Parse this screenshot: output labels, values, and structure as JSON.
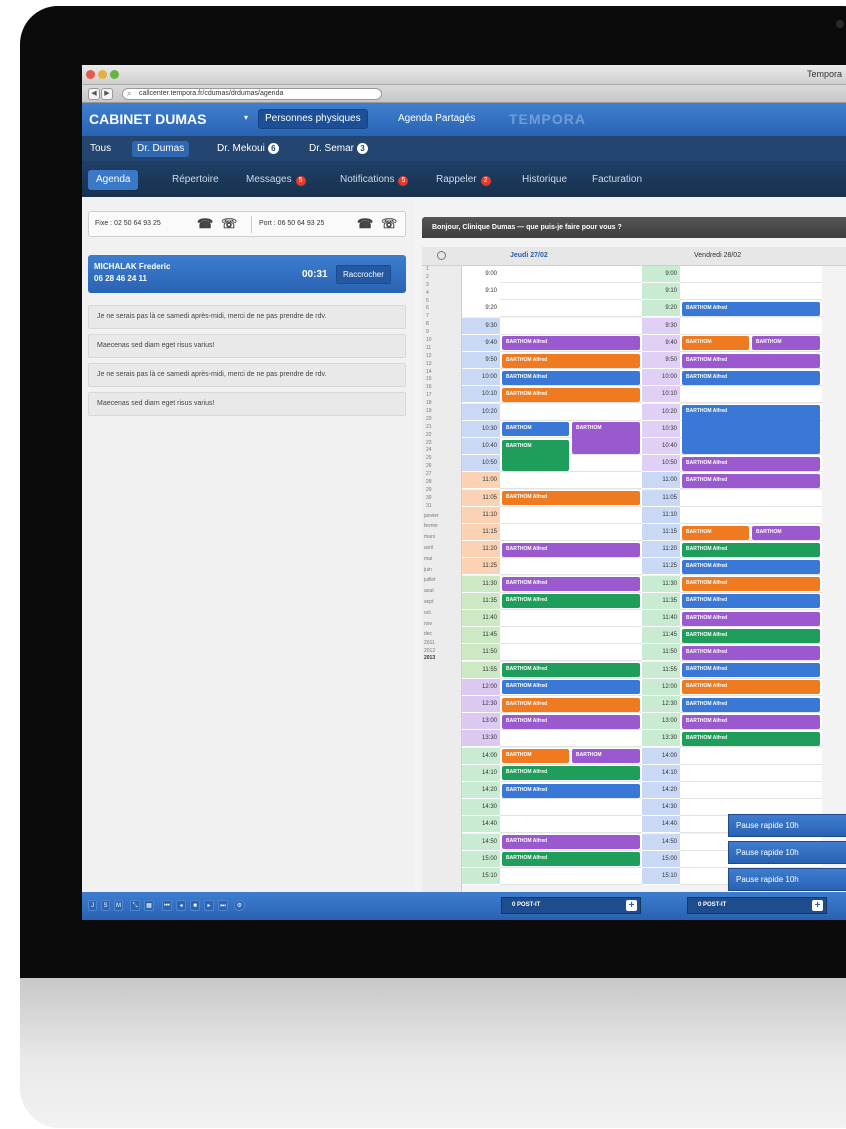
{
  "window": {
    "title": "Tempora",
    "url": "callcenter.tempora.fr/cdumas/drdumas/agenda"
  },
  "header": {
    "cabinet": "CABINET DUMAS",
    "caret": "▾",
    "segments": [
      "Personnes physiques",
      "Agenda Partagés"
    ],
    "logo": "TEMPORA"
  },
  "doctors": [
    {
      "label": "Tous"
    },
    {
      "label": "Dr. Dumas",
      "active": true
    },
    {
      "label": "Dr. Mekoui",
      "badge": "6"
    },
    {
      "label": "Dr. Semar",
      "badge": "3"
    }
  ],
  "tabs": [
    {
      "label": "Agenda",
      "active": true
    },
    {
      "label": "Répertoire"
    },
    {
      "label": "Messages",
      "badge": "5"
    },
    {
      "label": "Notifications",
      "badge": "5"
    },
    {
      "label": "Rappeler",
      "badge": "2"
    },
    {
      "label": "Historique"
    },
    {
      "label": "Facturation"
    }
  ],
  "phones": {
    "fixe": "Fixe : 02 50 64 93 25",
    "port": "Port : 06 50 64 93 25"
  },
  "call": {
    "name": "MICHALAK Frederic",
    "number": "06 28 46 24 11",
    "duration": "00:31",
    "hangup": "Raccrocher"
  },
  "notes": [
    "Je ne serais pas là ce samedi après-midi, merci de ne pas prendre de rdv.",
    "Maecenas sed diam eget risus varius!",
    "Je ne serais pas là ce samedi après-midi, merci de ne pas prendre de rdv.",
    "Maecenas sed diam eget risus varius!"
  ],
  "agenda": {
    "greeting": "Bonjour, Clinique Dumas — que puis-je faire pour vous ?",
    "days": [
      "Jeudi 27/02",
      "Vendredi 28/02"
    ],
    "times": [
      "9:00",
      "9:10",
      "9:20",
      "9:30",
      "9:40",
      "9:50",
      "10:00",
      "10:10",
      "10:20",
      "10:30",
      "10:40",
      "10:50",
      "11:00",
      "11:05",
      "11:10",
      "11:15",
      "11:20",
      "11:25",
      "11:30",
      "11:35",
      "11:40",
      "11:45",
      "11:50",
      "11:55",
      "12:00",
      "12:30",
      "13:00",
      "13:30",
      "14:00",
      "14:10",
      "14:20",
      "14:30",
      "14:40",
      "14:50",
      "15:00",
      "15:10"
    ],
    "minical": {
      "days": [
        "1",
        "2",
        "3",
        "4",
        "5",
        "6",
        "7",
        "8",
        "9",
        "10",
        "11",
        "12",
        "13",
        "14",
        "15",
        "16",
        "17",
        "18",
        "19",
        "20",
        "21",
        "22",
        "23",
        "24",
        "25",
        "26",
        "27",
        "28",
        "29",
        "30",
        "31"
      ],
      "months": [
        "janvier",
        "fevrier",
        "mars",
        "avril",
        "mai",
        "juin",
        "juillet",
        "aout",
        "sept",
        "oct.",
        "nov",
        "dec"
      ],
      "years": [
        "2011",
        "2012",
        "2013"
      ]
    },
    "pauses": [
      {
        "label": "Pause rapide 10h"
      },
      {
        "label": "Pause rapide 10h"
      },
      {
        "label": "Pause rapide 10h"
      }
    ]
  },
  "events_day1": [
    {
      "row": 4,
      "label": "BARTHOM Alfred",
      "color": "#9b59d0",
      "span": 1,
      "part": "full"
    },
    {
      "row": 5,
      "label": "BARTHOM Alfred",
      "color": "#f07a1f",
      "span": 1,
      "part": "full"
    },
    {
      "row": 6,
      "label": "BARTHOM Alfred",
      "color": "#3a78d8",
      "span": 1,
      "part": "full"
    },
    {
      "row": 7,
      "label": "BARTHOM Alfred",
      "color": "#f07a1f",
      "span": 1,
      "part": "full"
    },
    {
      "row": 9,
      "label": "BARTHOM",
      "color": "#3a78d8",
      "span": 1,
      "part": "left"
    },
    {
      "row": 9,
      "label": "BARTHOM",
      "color": "#9b59d0",
      "span": 2,
      "part": "right"
    },
    {
      "row": 10,
      "label": "BARTHOM",
      "color": "#1e9e5a",
      "span": 2,
      "part": "left"
    },
    {
      "row": 13,
      "label": "BARTHOM Alfred",
      "color": "#f07a1f",
      "span": 1,
      "part": "full"
    },
    {
      "row": 16,
      "label": "BARTHOM Alfred",
      "color": "#9b59d0",
      "span": 1,
      "part": "full"
    },
    {
      "row": 18,
      "label": "BARTHOM Alfred",
      "color": "#9b59d0",
      "span": 1,
      "part": "full"
    },
    {
      "row": 19,
      "label": "BARTHOM Alfred",
      "color": "#1e9e5a",
      "span": 1,
      "part": "full"
    },
    {
      "row": 23,
      "label": "BARTHOM Alfred",
      "color": "#1e9e5a",
      "span": 1,
      "part": "full"
    },
    {
      "row": 24,
      "label": "BARTHOM Alfred",
      "color": "#3a78d8",
      "span": 1,
      "part": "full"
    },
    {
      "row": 25,
      "label": "BARTHOM Alfred",
      "color": "#f07a1f",
      "span": 1,
      "part": "full"
    },
    {
      "row": 26,
      "label": "BARTHOM Alfred",
      "color": "#9b59d0",
      "span": 1,
      "part": "full"
    },
    {
      "row": 28,
      "label": "BARTHOM",
      "color": "#f07a1f",
      "span": 1,
      "part": "left"
    },
    {
      "row": 28,
      "label": "BARTHOM",
      "color": "#9b59d0",
      "span": 1,
      "part": "right"
    },
    {
      "row": 29,
      "label": "BARTHOM Alfred",
      "color": "#1e9e5a",
      "span": 1,
      "part": "full"
    },
    {
      "row": 30,
      "label": "BARTHOM Alfred",
      "color": "#3a78d8",
      "span": 1,
      "part": "full"
    },
    {
      "row": 33,
      "label": "BARTHOM Alfred",
      "color": "#9b59d0",
      "span": 1,
      "part": "full"
    },
    {
      "row": 34,
      "label": "BARTHOM Alfred",
      "color": "#1e9e5a",
      "span": 1,
      "part": "full"
    }
  ],
  "events_day2": [
    {
      "row": 2,
      "label": "BARTHOM Alfred",
      "color": "#3a78d8",
      "span": 1,
      "part": "full"
    },
    {
      "row": 4,
      "label": "BARTHOM",
      "color": "#f07a1f",
      "span": 1,
      "part": "left"
    },
    {
      "row": 4,
      "label": "BARTHOM",
      "color": "#9b59d0",
      "span": 1,
      "part": "right"
    },
    {
      "row": 5,
      "label": "BARTHOM Alfred",
      "color": "#9b59d0",
      "span": 1,
      "part": "full"
    },
    {
      "row": 6,
      "label": "BARTHOM Alfred",
      "color": "#3a78d8",
      "span": 1,
      "part": "full"
    },
    {
      "row": 8,
      "label": "BARTHOM Alfred",
      "color": "#3a78d8",
      "span": 3,
      "part": "full"
    },
    {
      "row": 11,
      "label": "BARTHOM Alfred",
      "color": "#9b59d0",
      "span": 1,
      "part": "full"
    },
    {
      "row": 12,
      "label": "BARTHOM Alfred",
      "color": "#9b59d0",
      "span": 1,
      "part": "full"
    },
    {
      "row": 15,
      "label": "BARTHOM",
      "color": "#f07a1f",
      "span": 1,
      "part": "left"
    },
    {
      "row": 15,
      "label": "BARTHOM",
      "color": "#9b59d0",
      "span": 1,
      "part": "right"
    },
    {
      "row": 16,
      "label": "BARTHOM Alfred",
      "color": "#1e9e5a",
      "span": 1,
      "part": "full"
    },
    {
      "row": 17,
      "label": "BARTHOM Alfred",
      "color": "#3a78d8",
      "span": 1,
      "part": "full"
    },
    {
      "row": 18,
      "label": "BARTHOM Alfred",
      "color": "#f07a1f",
      "span": 1,
      "part": "full"
    },
    {
      "row": 19,
      "label": "BARTHOM Alfred",
      "color": "#3a78d8",
      "span": 1,
      "part": "full"
    },
    {
      "row": 20,
      "label": "BARTHOM Alfred",
      "color": "#9b59d0",
      "span": 1,
      "part": "full"
    },
    {
      "row": 21,
      "label": "BARTHOM Alfred",
      "color": "#1e9e5a",
      "span": 1,
      "part": "full"
    },
    {
      "row": 22,
      "label": "BARTHOM Alfred",
      "color": "#9b59d0",
      "span": 1,
      "part": "full"
    },
    {
      "row": 23,
      "label": "BARTHOM Alfred",
      "color": "#3a78d8",
      "span": 1,
      "part": "full"
    },
    {
      "row": 24,
      "label": "BARTHOM Alfred",
      "color": "#f07a1f",
      "span": 1,
      "part": "full"
    },
    {
      "row": 25,
      "label": "BARTHOM Alfred",
      "color": "#3a78d8",
      "span": 1,
      "part": "full"
    },
    {
      "row": 26,
      "label": "BARTHOM Alfred",
      "color": "#9b59d0",
      "span": 1,
      "part": "full"
    },
    {
      "row": 27,
      "label": "BARTHOM Alfred",
      "color": "#1e9e5a",
      "span": 1,
      "part": "full"
    }
  ],
  "footer": {
    "postit": "0 POST-IT",
    "plus": "+",
    "tools": [
      "J",
      "S",
      "M"
    ]
  },
  "colors": {
    "blue": "#3a78d8",
    "purple": "#9b59d0",
    "orange": "#f07a1f",
    "green": "#1e9e5a",
    "header": "#2a63b3"
  }
}
